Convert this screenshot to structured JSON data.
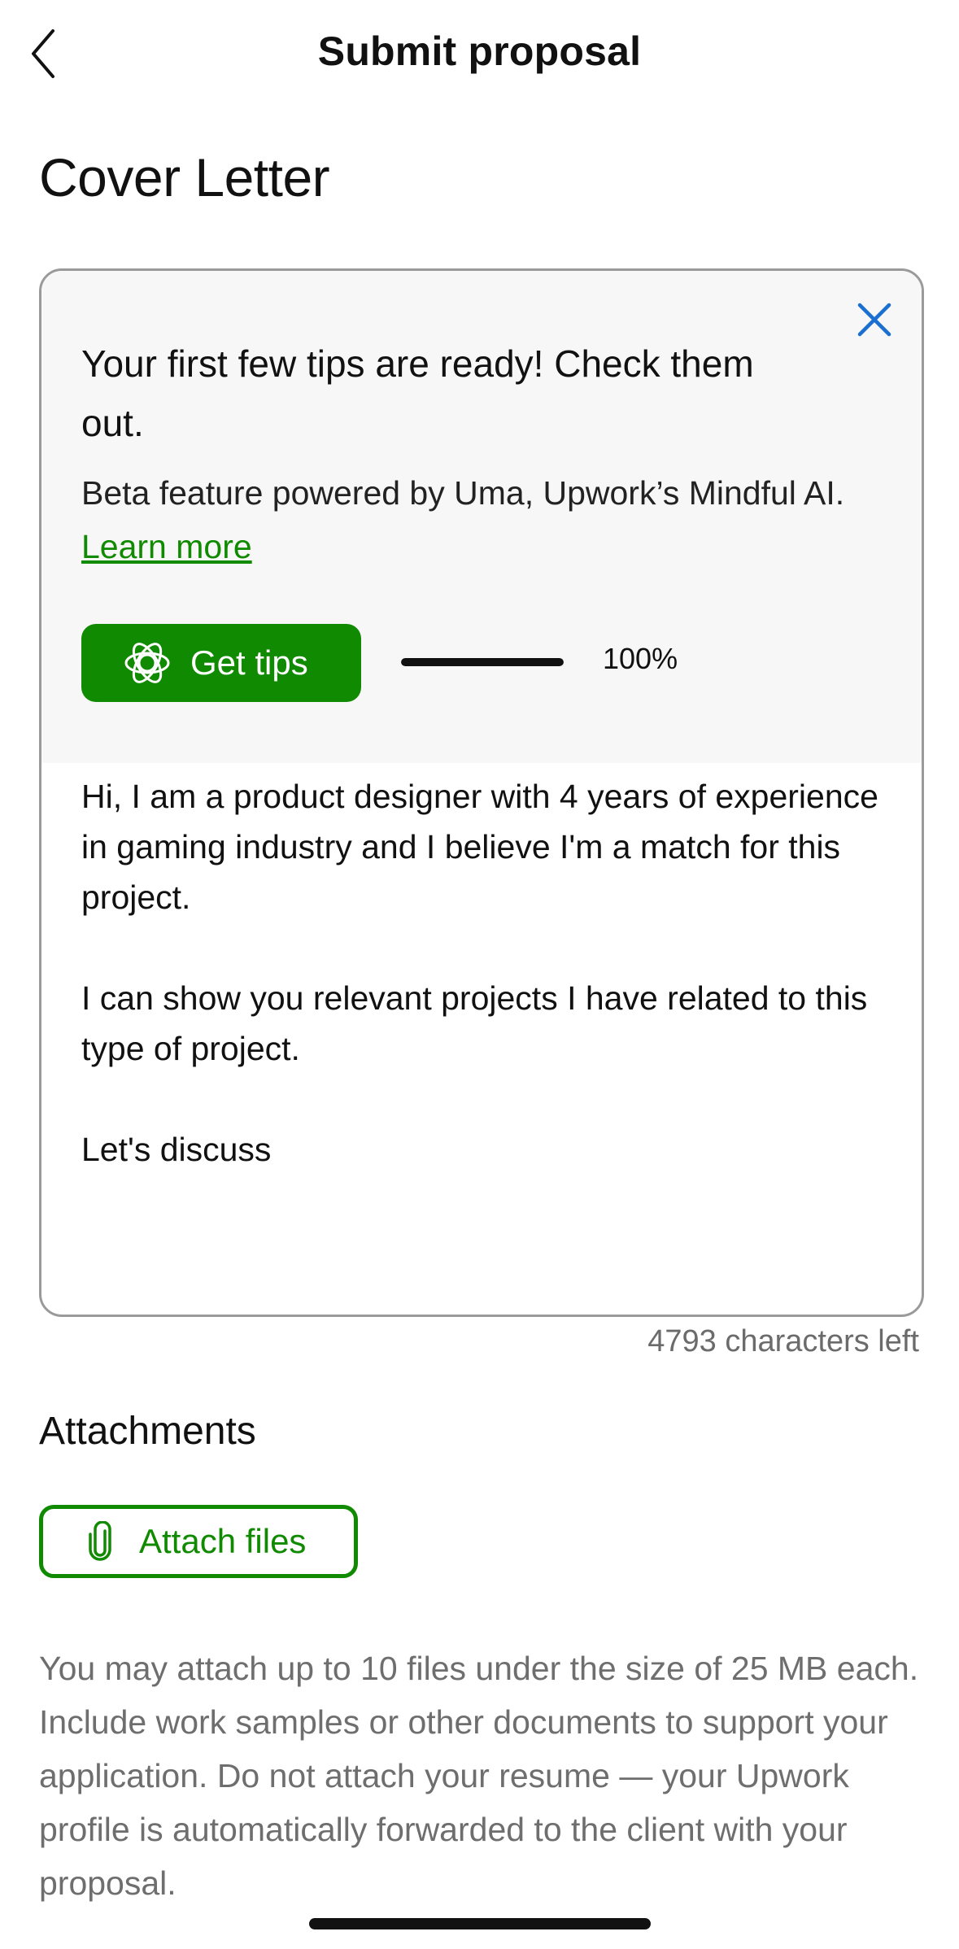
{
  "header": {
    "title": "Submit proposal"
  },
  "section": {
    "title": "Cover Letter"
  },
  "tips": {
    "title": "Your first few tips are ready! Check them out.",
    "description": "Beta feature powered by Uma, Upwork’s Mindful AI.",
    "learn_more": "Learn more",
    "button_label": "Get tips",
    "progress_text": "100%",
    "progress_value": 1.0
  },
  "letter": {
    "paragraphs": [
      "Hi, I am a product designer with 4 years of experience in gaming industry and I believe I'm a match for this project.",
      "I can show you relevant projects I have related to this type of project.",
      "Let's discuss"
    ],
    "chars_left": "4793 characters left"
  },
  "attachments": {
    "title": "Attachments",
    "button_label": "Attach files",
    "info": "You may attach up to 10 files under the size of 25 MB each. Include work samples or other documents to support your application. Do not attach your resume — your Upwork profile is automatically forwarded to the client with your proposal."
  },
  "colors": {
    "brand_green": "#108a00",
    "close_blue": "#1a6fd0",
    "text_muted": "#6e6e6e"
  },
  "icons": {
    "back": "chevron-left-icon",
    "close": "close-icon",
    "uma": "uma-icon",
    "attach": "paperclip-icon"
  }
}
